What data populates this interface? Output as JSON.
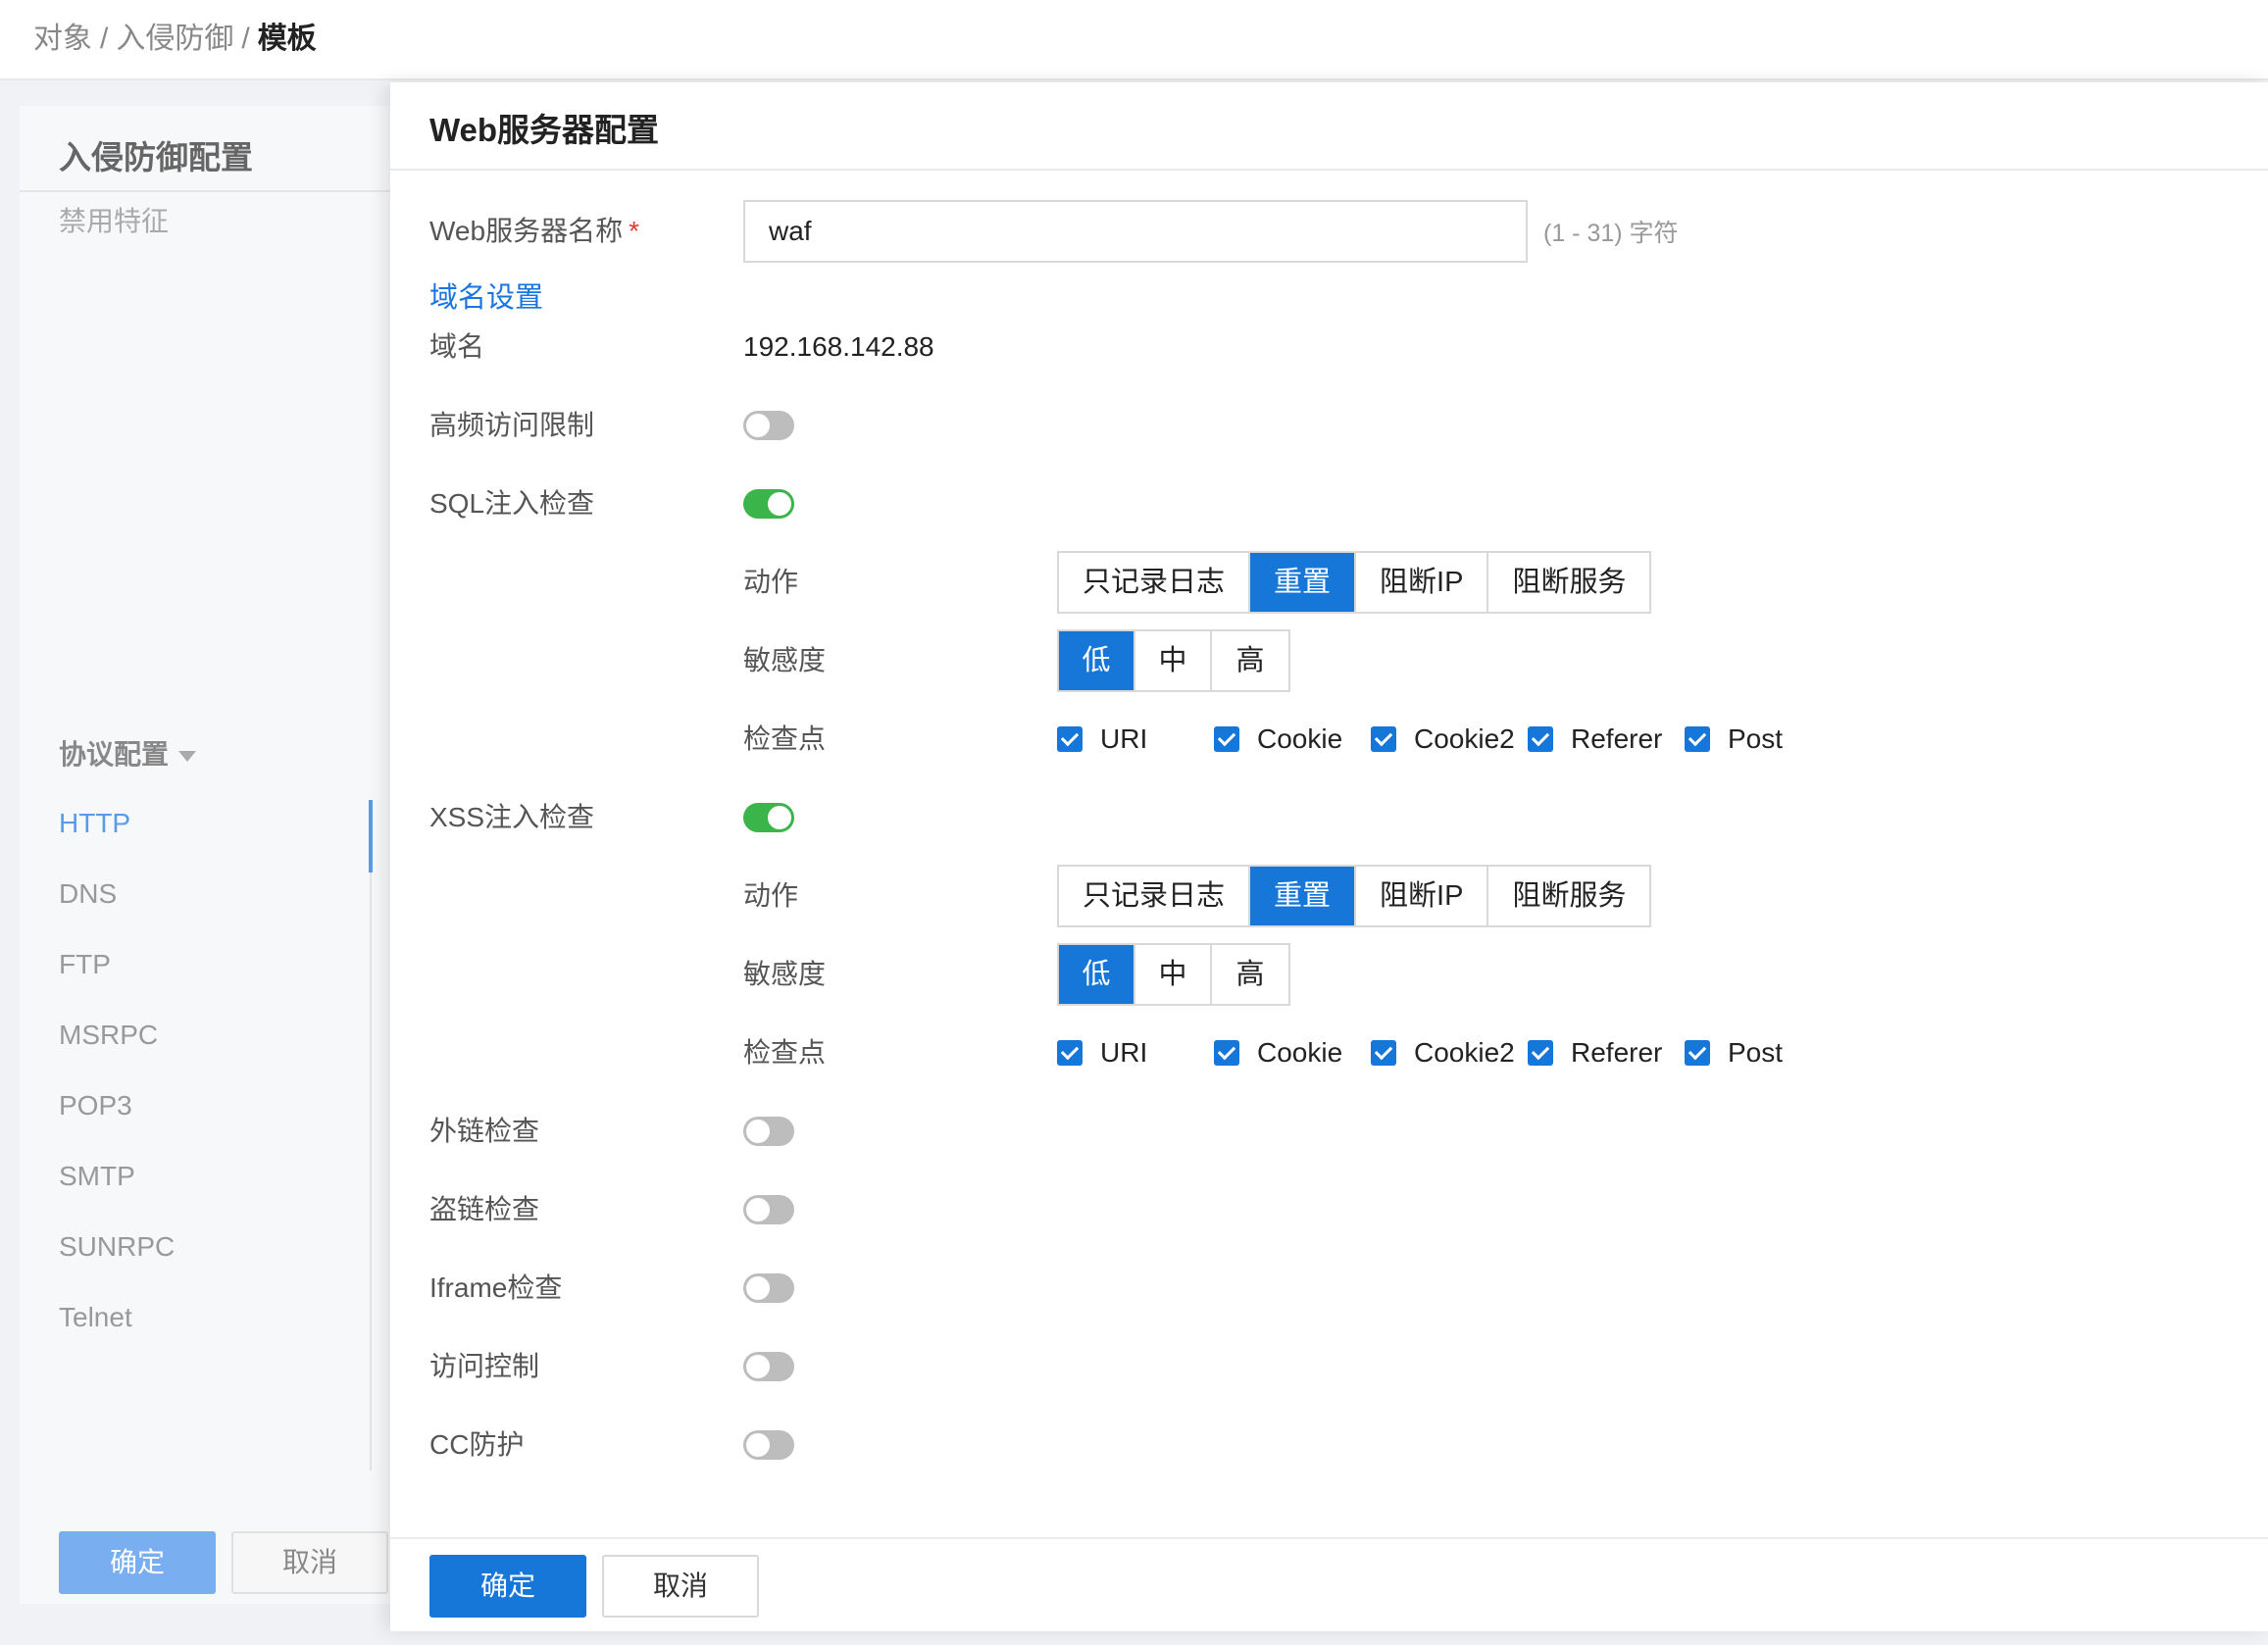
{
  "breadcrumb": {
    "items": [
      "对象",
      "入侵防御"
    ],
    "separator": "/",
    "current": "模板"
  },
  "background_panel": {
    "title": "入侵防御配置",
    "disabled_features": "禁用特征",
    "protocol_section": "协议配置",
    "protocols": [
      "HTTP",
      "DNS",
      "FTP",
      "MSRPC",
      "POP3",
      "SMTP",
      "SUNRPC",
      "Telnet"
    ],
    "active_protocol": "HTTP",
    "ok_label": "确定",
    "cancel_label": "取消"
  },
  "dialog": {
    "title": "Web服务器配置",
    "server_name": {
      "label": "Web服务器名称",
      "required_mark": "*",
      "value": "waf",
      "hint": "(1 - 31) 字符"
    },
    "domain_settings": {
      "title": "域名设置",
      "domain_label": "域名",
      "domain_value": "192.168.142.88"
    },
    "high_freq_limit": {
      "label": "高频访问限制",
      "enabled": false
    },
    "sql_check": {
      "label": "SQL注入检查",
      "enabled": true,
      "action_label": "动作",
      "actions": [
        "只记录日志",
        "重置",
        "阻断IP",
        "阻断服务"
      ],
      "selected_action": "重置",
      "sensitivity_label": "敏感度",
      "sensitivity": [
        "低",
        "中",
        "高"
      ],
      "selected_sensitivity": "低",
      "checkpoints_label": "检查点",
      "checkpoints": [
        "URI",
        "Cookie",
        "Cookie2",
        "Referer",
        "Post"
      ]
    },
    "xss_check": {
      "label": "XSS注入检查",
      "enabled": true,
      "action_label": "动作",
      "actions": [
        "只记录日志",
        "重置",
        "阻断IP",
        "阻断服务"
      ],
      "selected_action": "重置",
      "sensitivity_label": "敏感度",
      "sensitivity": [
        "低",
        "中",
        "高"
      ],
      "selected_sensitivity": "低",
      "checkpoints_label": "检查点",
      "checkpoints": [
        "URI",
        "Cookie",
        "Cookie2",
        "Referer",
        "Post"
      ]
    },
    "external_link_check": {
      "label": "外链检查",
      "enabled": false
    },
    "hotlink_check": {
      "label": "盗链检查",
      "enabled": false
    },
    "iframe_check": {
      "label": "Iframe检查",
      "enabled": false
    },
    "access_control": {
      "label": "访问控制",
      "enabled": false
    },
    "cc_protection": {
      "label": "CC防护",
      "enabled": false
    },
    "ok_label": "确定",
    "cancel_label": "取消"
  },
  "colors": {
    "primary": "#1677d9",
    "toggle_on": "#3bb54a",
    "toggle_off": "#bdbdbd",
    "link": "#1a75e0",
    "required": "#e53935"
  }
}
